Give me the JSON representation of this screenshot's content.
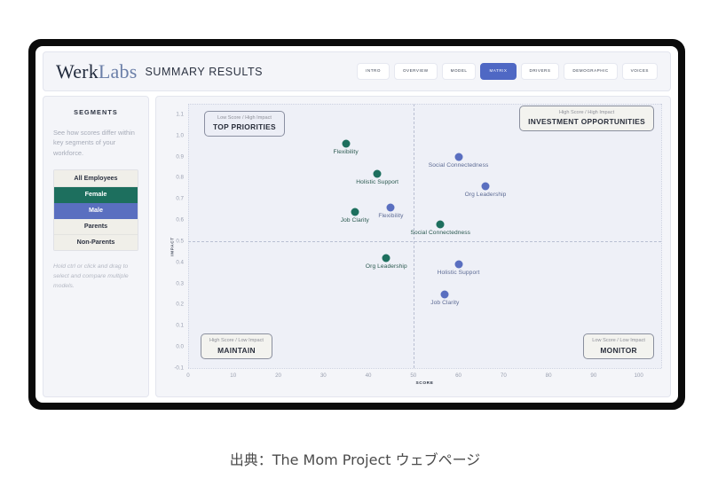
{
  "header": {
    "brand_werk": "Werk",
    "brand_labs": "Labs",
    "summary_title": "SUMMARY RESULTS",
    "tabs": [
      {
        "label": "INTRO",
        "active": false
      },
      {
        "label": "OVERVIEW",
        "active": false
      },
      {
        "label": "MODEL",
        "active": false
      },
      {
        "label": "MATRIX",
        "active": true
      },
      {
        "label": "DRIVERS",
        "active": false
      },
      {
        "label": "DEMOGRAPHIC",
        "active": false
      },
      {
        "label": "VOICES",
        "active": false
      }
    ]
  },
  "sidebar": {
    "title": "SEGMENTS",
    "description": "See how scores differ within key segments of your workforce.",
    "segments": [
      {
        "label": "All Employees",
        "state": "default"
      },
      {
        "label": "Female",
        "state": "female"
      },
      {
        "label": "Male",
        "state": "male"
      },
      {
        "label": "Parents",
        "state": "default"
      },
      {
        "label": "Non-Parents",
        "state": "default"
      }
    ],
    "hint": "Hold ctrl or click and drag to select and compare multiple models."
  },
  "quadrants": {
    "top_left": {
      "sub": "Low Score / High Impact",
      "main": "TOP PRIORITIES"
    },
    "top_right": {
      "sub": "High Score / High Impact",
      "main": "INVESTMENT OPPORTUNITIES"
    },
    "bottom_left": {
      "sub": "High Score / Low Impact",
      "main": "MAINTAIN"
    },
    "bottom_right": {
      "sub": "Low Score / Low Impact",
      "main": "MONITOR"
    }
  },
  "colors": {
    "female": "#1d6f5e",
    "male": "#5a6fc0",
    "active_tab": "#4f68c4",
    "panel_bg": "#f4f5f9",
    "plot_bg": "#eef0f7"
  },
  "caption": "出典：The Mom Project ウェブページ",
  "chart_data": {
    "type": "scatter",
    "title": "",
    "xlabel": "SCORE",
    "ylabel": "IMPACT",
    "xlim": [
      0,
      105
    ],
    "ylim": [
      -0.1,
      1.15
    ],
    "xticks": [
      0,
      10,
      20,
      30,
      40,
      50,
      60,
      70,
      80,
      90,
      100
    ],
    "yticks": [
      1.1,
      1.0,
      0.9,
      0.8,
      0.7,
      0.6,
      0.5,
      0.4,
      0.3,
      0.2,
      0.1,
      0.0,
      -0.1
    ],
    "grid": false,
    "quadrant_divider_x": 50,
    "quadrant_divider_y": 0.5,
    "legend_position": "sidebar",
    "series": [
      {
        "name": "Female",
        "color": "#1d6f5e",
        "points": [
          {
            "label": "Flexibility",
            "x": 35,
            "y": 0.96
          },
          {
            "label": "Holistic Support",
            "x": 42,
            "y": 0.82
          },
          {
            "label": "Job Clarity",
            "x": 37,
            "y": 0.64
          },
          {
            "label": "Social Connectedness",
            "x": 56,
            "y": 0.58
          },
          {
            "label": "Org Leadership",
            "x": 44,
            "y": 0.42
          }
        ]
      },
      {
        "name": "Male",
        "color": "#5a6fc0",
        "points": [
          {
            "label": "Social Connectedness",
            "x": 60,
            "y": 0.9
          },
          {
            "label": "Org Leadership",
            "x": 66,
            "y": 0.76
          },
          {
            "label": "Flexibility",
            "x": 45,
            "y": 0.66
          },
          {
            "label": "Holistic Support",
            "x": 60,
            "y": 0.39
          },
          {
            "label": "Job Clarity",
            "x": 57,
            "y": 0.25
          }
        ]
      }
    ]
  }
}
